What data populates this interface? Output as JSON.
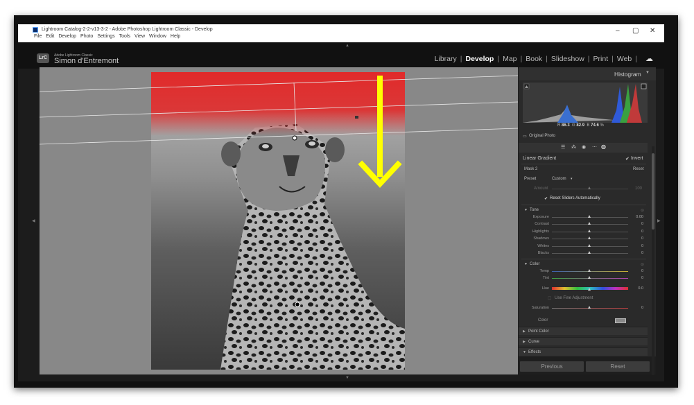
{
  "window": {
    "title": "Lightroom Catalog-2-2-v13-3-2 - Adobe Photoshop Lightroom Classic - Develop",
    "menu": [
      "File",
      "Edit",
      "Develop",
      "Photo",
      "Settings",
      "Tools",
      "View",
      "Window",
      "Help"
    ],
    "controls": {
      "minimize": "–",
      "maximize": "▢",
      "close": "✕"
    }
  },
  "identity": {
    "logo": "LrC",
    "product": "Adobe Lightroom Classic",
    "user": "Simon d'Entremont"
  },
  "modules": {
    "items": [
      "Library",
      "Develop",
      "Map",
      "Book",
      "Slideshow",
      "Print",
      "Web"
    ],
    "active": "Develop"
  },
  "histogram": {
    "title": "Histogram",
    "readout": {
      "r_label": "R",
      "r": "86.3",
      "g_label": "G",
      "g": "82.9",
      "b_label": "B",
      "b": "74.6",
      "unit": "%"
    },
    "original_photo": "Original Photo"
  },
  "mask": {
    "tool": "Linear Gradient",
    "invert_label": "Invert",
    "invert_checked": true,
    "mask_name": "Mask 2",
    "reset": "Reset",
    "preset_label": "Preset",
    "preset_value": "Custom",
    "amount_label": "Amount",
    "amount_value": "100",
    "reset_sliders_label": "Reset Sliders Automatically",
    "reset_sliders_checked": true
  },
  "tone": {
    "title": "Tone",
    "sliders": [
      {
        "label": "Exposure",
        "value": "0.00"
      },
      {
        "label": "Contrast",
        "value": "0"
      },
      {
        "label": "Highlights",
        "value": "0"
      },
      {
        "label": "Shadows",
        "value": "0"
      },
      {
        "label": "Whites",
        "value": "0"
      },
      {
        "label": "Blacks",
        "value": "0"
      }
    ]
  },
  "color": {
    "title": "Color",
    "temp_label": "Temp",
    "temp_value": "0",
    "tint_label": "Tint",
    "tint_value": "0",
    "hue_label": "Hue",
    "hue_value": "0.0",
    "fine_label": "Use Fine Adjustment",
    "saturation_label": "Saturation",
    "saturation_value": "0",
    "color_label": "Color"
  },
  "sections": {
    "point_color": "Point Color",
    "curve": "Curve",
    "effects": "Effects"
  },
  "buttons": {
    "previous": "Previous",
    "reset": "Reset"
  },
  "colors": {
    "mask_overlay": "#e02a2a",
    "arrow": "#ffff00",
    "panel": "#2a2a2a",
    "work_bg": "#888888"
  }
}
